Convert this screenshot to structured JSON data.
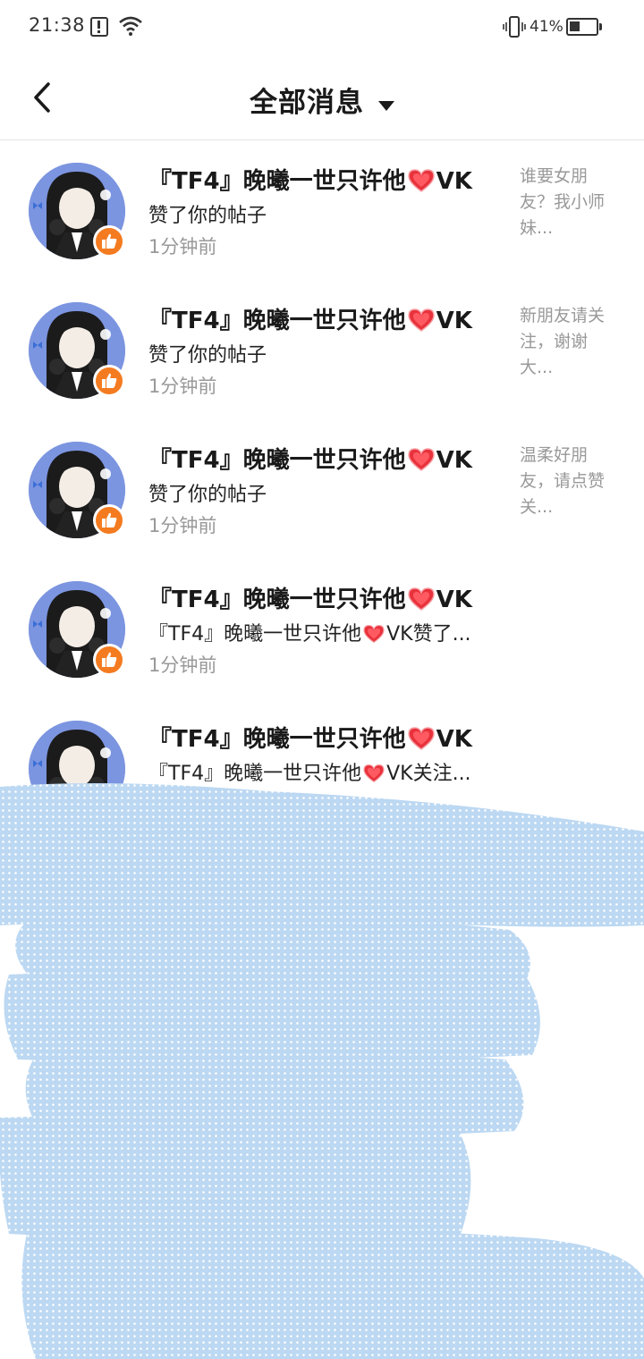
{
  "status_bar": {
    "time": "21:38",
    "battery": "41%",
    "battery_level": 0.41,
    "icons": [
      "alert-icon",
      "wifi-icon",
      "vibrate-icon",
      "battery-icon"
    ]
  },
  "header": {
    "title": "全部消息",
    "back_icon": "chevron-left-icon",
    "dropdown_icon": "caret-down-icon"
  },
  "messages": [
    {
      "name_prefix": "『TF4』晚曦一世只许他",
      "name_suffix": "VK",
      "action": "赞了你的帖子",
      "time": "1分钟前",
      "snippet": "谁要女朋友？我小师妹..."
    },
    {
      "name_prefix": "『TF4』晚曦一世只许他",
      "name_suffix": "VK",
      "action": "赞了你的帖子",
      "time": "1分钟前",
      "snippet": "新朋友请关注，谢谢大..."
    },
    {
      "name_prefix": "『TF4』晚曦一世只许他",
      "name_suffix": "VK",
      "action": "赞了你的帖子",
      "time": "1分钟前",
      "snippet": "温柔好朋友，请点赞关..."
    },
    {
      "name_prefix": "『TF4』晚曦一世只许他",
      "name_suffix": "VK",
      "action_prefix": "『TF4』晚曦一世只许他",
      "action_suffix": "VK赞了...",
      "time": "1分钟前"
    },
    {
      "name_prefix": "『TF4』晚曦一世只许他",
      "name_suffix": "VK",
      "action_prefix": "『TF4』晚曦一世只许他",
      "action_suffix": "VK关注..."
    }
  ],
  "colors": {
    "like_badge": "#f47b20",
    "avatar_bg": "#7c95e0",
    "heart": "#e8323c",
    "scribble": "#bcd8f2"
  }
}
